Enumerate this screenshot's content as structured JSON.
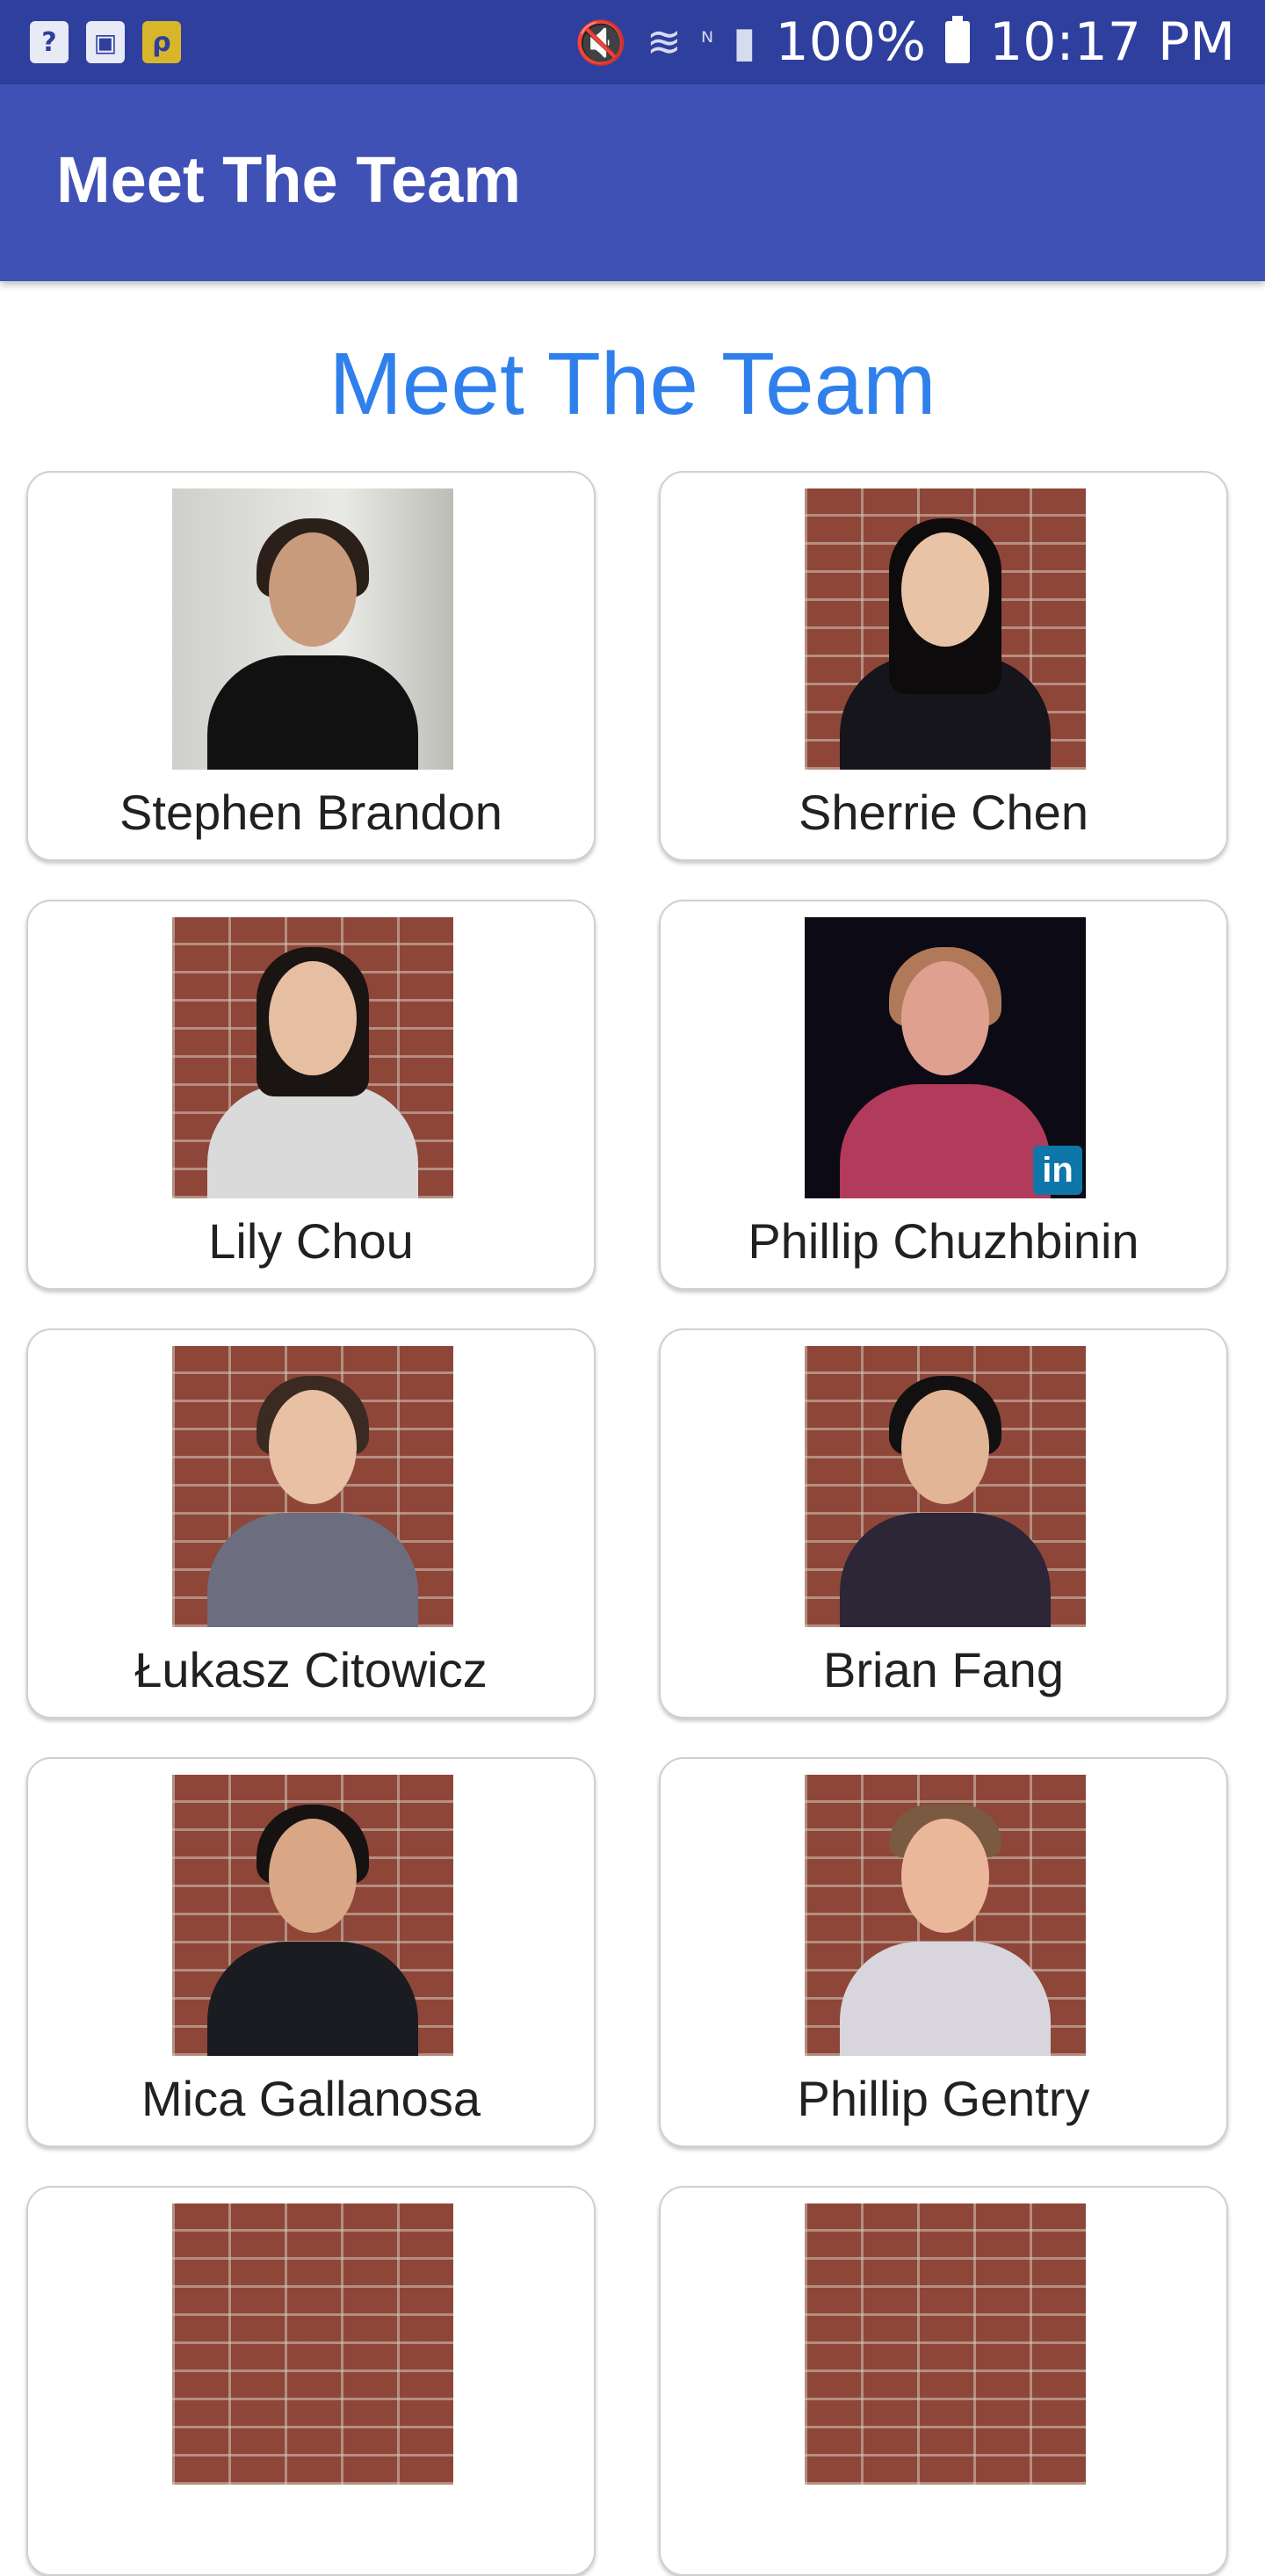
{
  "status_bar": {
    "battery": "100%",
    "time": "10:17 PM",
    "icons": [
      "help-icon",
      "image-icon",
      "app-notification-icon",
      "mute-icon",
      "wifi-icon",
      "nfc-icon",
      "signal-icon",
      "battery-icon"
    ]
  },
  "app_bar": {
    "title": "Meet The Team"
  },
  "page": {
    "heading": "Meet The Team"
  },
  "team": [
    {
      "name": "Stephen Brandon"
    },
    {
      "name": "Sherrie Chen"
    },
    {
      "name": "Lily Chou"
    },
    {
      "name": "Phillip Chuzhbinin"
    },
    {
      "name": "Łukasz Citowicz"
    },
    {
      "name": "Brian Fang"
    },
    {
      "name": "Mica Gallanosa"
    },
    {
      "name": "Phillip Gentry"
    }
  ],
  "colors": {
    "status_bar": "#2f3f9e",
    "app_bar": "#3f51b5",
    "heading": "#2f80ec",
    "linkedin": "#0e76a8"
  }
}
